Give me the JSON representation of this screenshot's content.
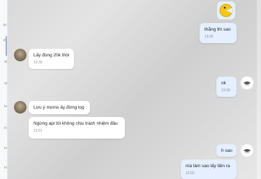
{
  "sidebar": {
    "labels": [
      "pc",
      "ấy",
      "ải",
      "ut",
      "ìa",
      "ìo",
      "ìo",
      "ìo",
      "ìo"
    ]
  },
  "messages": [
    {
      "id": "m1",
      "sender": "me",
      "type": "sticker",
      "sticker": "pacman-face-sticker"
    },
    {
      "id": "m2",
      "sender": "me",
      "text": "thắng thì sao",
      "time": "13:30"
    },
    {
      "id": "m3",
      "sender": "other",
      "text": "Lấy đúng 20k thôi",
      "time": "13:30"
    },
    {
      "id": "m4",
      "sender": "me",
      "text": "ok",
      "time": "13:30"
    },
    {
      "id": "m5",
      "sender": "other",
      "text": "Lưu ý momo ấy đừng log"
    },
    {
      "id": "m6",
      "sender": "other",
      "text": "Ngừng api tôi không chịu trách nhiệm đâu",
      "time": "13:31"
    },
    {
      "id": "m7",
      "sender": "me",
      "text": "h sao"
    },
    {
      "id": "m8",
      "sender": "me",
      "text": "mà làm sao lấy tiền ra",
      "time": "13:32"
    }
  ],
  "colors": {
    "my_bubble": "#e5efff",
    "other_bubble": "#ffffff",
    "sticker_yellow": "#f5c518"
  }
}
